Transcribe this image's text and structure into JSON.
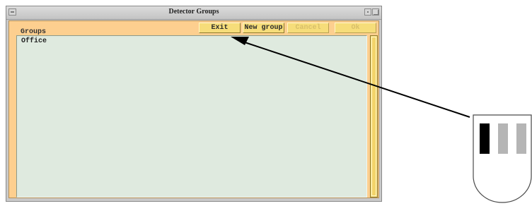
{
  "window": {
    "title": "Detector Groups",
    "groups_label": "Groups",
    "buttons": {
      "exit": "Exit",
      "new_group": "New group",
      "cancel": "Cancel",
      "ok": "Ok"
    },
    "group_list": [
      "Office"
    ]
  },
  "colors": {
    "panel": "#fdcf8f",
    "list_bg": "#dfeadf",
    "button": "#f6dd7a",
    "arrow": "#000000"
  },
  "icons": [
    "window-menu-icon",
    "minimize-icon",
    "maximize-icon",
    "arrow-pointer",
    "detector-icon"
  ]
}
